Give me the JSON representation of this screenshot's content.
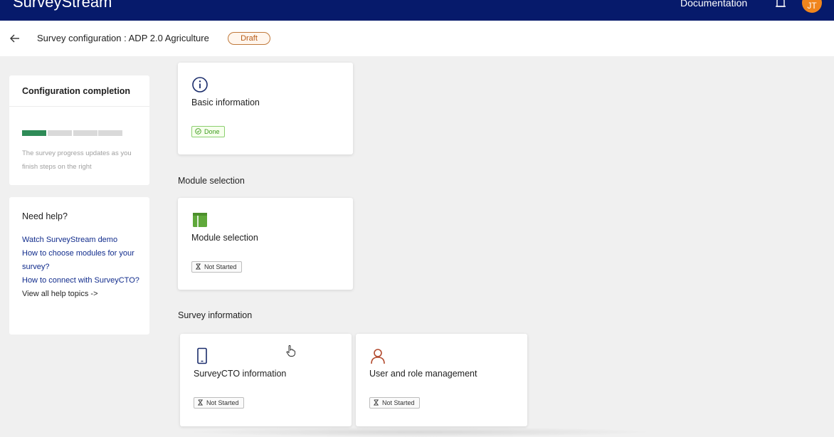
{
  "topbar": {
    "brand": "SurveyStream",
    "documentation_label": "Documentation",
    "avatar_initials": "JT",
    "bg_color": "#061a6b"
  },
  "header": {
    "title": "Survey configuration : ADP 2.0 Agriculture",
    "status_badge": "Draft"
  },
  "completion": {
    "title": "Configuration completion",
    "progress": {
      "completed_steps": 1,
      "total_steps": 4,
      "color": "#2e8b57"
    },
    "note": "The survey progress updates as you finish steps on the right"
  },
  "help": {
    "title": "Need help?",
    "links": [
      "Watch SurveyStream demo",
      "How to choose modules for your survey?",
      "How to connect with SurveyCTO?",
      "View all help topics ->"
    ]
  },
  "sections": {
    "module_selection": "Module selection",
    "survey_information": "Survey information"
  },
  "cards": {
    "basic_information": {
      "title": "Basic information",
      "status": "Done",
      "icon": "info-icon"
    },
    "module_selection": {
      "title": "Module selection",
      "status": "Not Started",
      "icon": "layout-icon"
    },
    "surveycto_information": {
      "title": "SurveyCTO information",
      "status": "Not Started",
      "icon": "mobile-icon"
    },
    "user_role_management": {
      "title": "User and role management",
      "status": "Not Started",
      "icon": "user-icon"
    }
  }
}
